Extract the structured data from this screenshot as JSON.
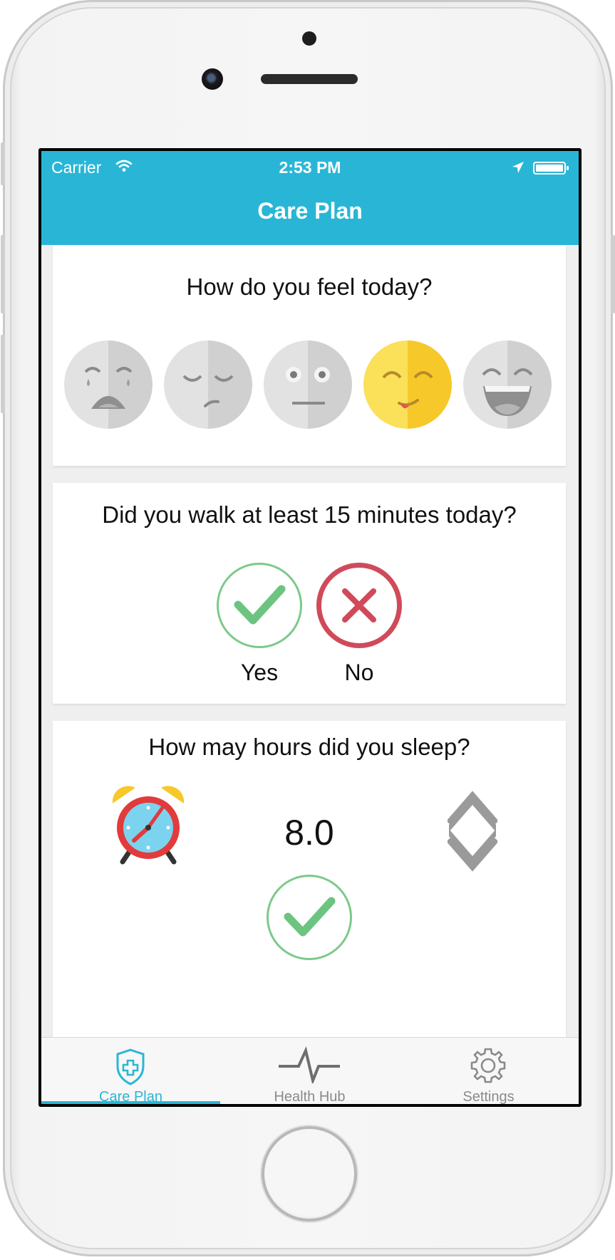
{
  "status_bar": {
    "carrier": "Carrier",
    "time": "2:53 PM"
  },
  "nav": {
    "title": "Care Plan"
  },
  "mood_card": {
    "question": "How do you feel today?",
    "options": [
      "crying-face-icon",
      "sad-face-icon",
      "neutral-face-icon",
      "smiling-face-icon",
      "laughing-face-icon"
    ],
    "selected_index": 3
  },
  "walk_card": {
    "question": "Did you walk at least 15 minutes today?",
    "yes_label": "Yes",
    "no_label": "No"
  },
  "sleep_card": {
    "question": "How may hours did you sleep?",
    "value": "8.0"
  },
  "tabs": [
    {
      "label": "Care Plan",
      "icon": "shield-plus-icon",
      "active": true
    },
    {
      "label": "Health Hub",
      "icon": "heartbeat-icon",
      "active": false
    },
    {
      "label": "Settings",
      "icon": "gear-icon",
      "active": false
    }
  ],
  "colors": {
    "accent": "#29b6d6",
    "yes_green": "#7dc98b",
    "no_red": "#d04a5a",
    "selected_face": "#fbd63a"
  }
}
